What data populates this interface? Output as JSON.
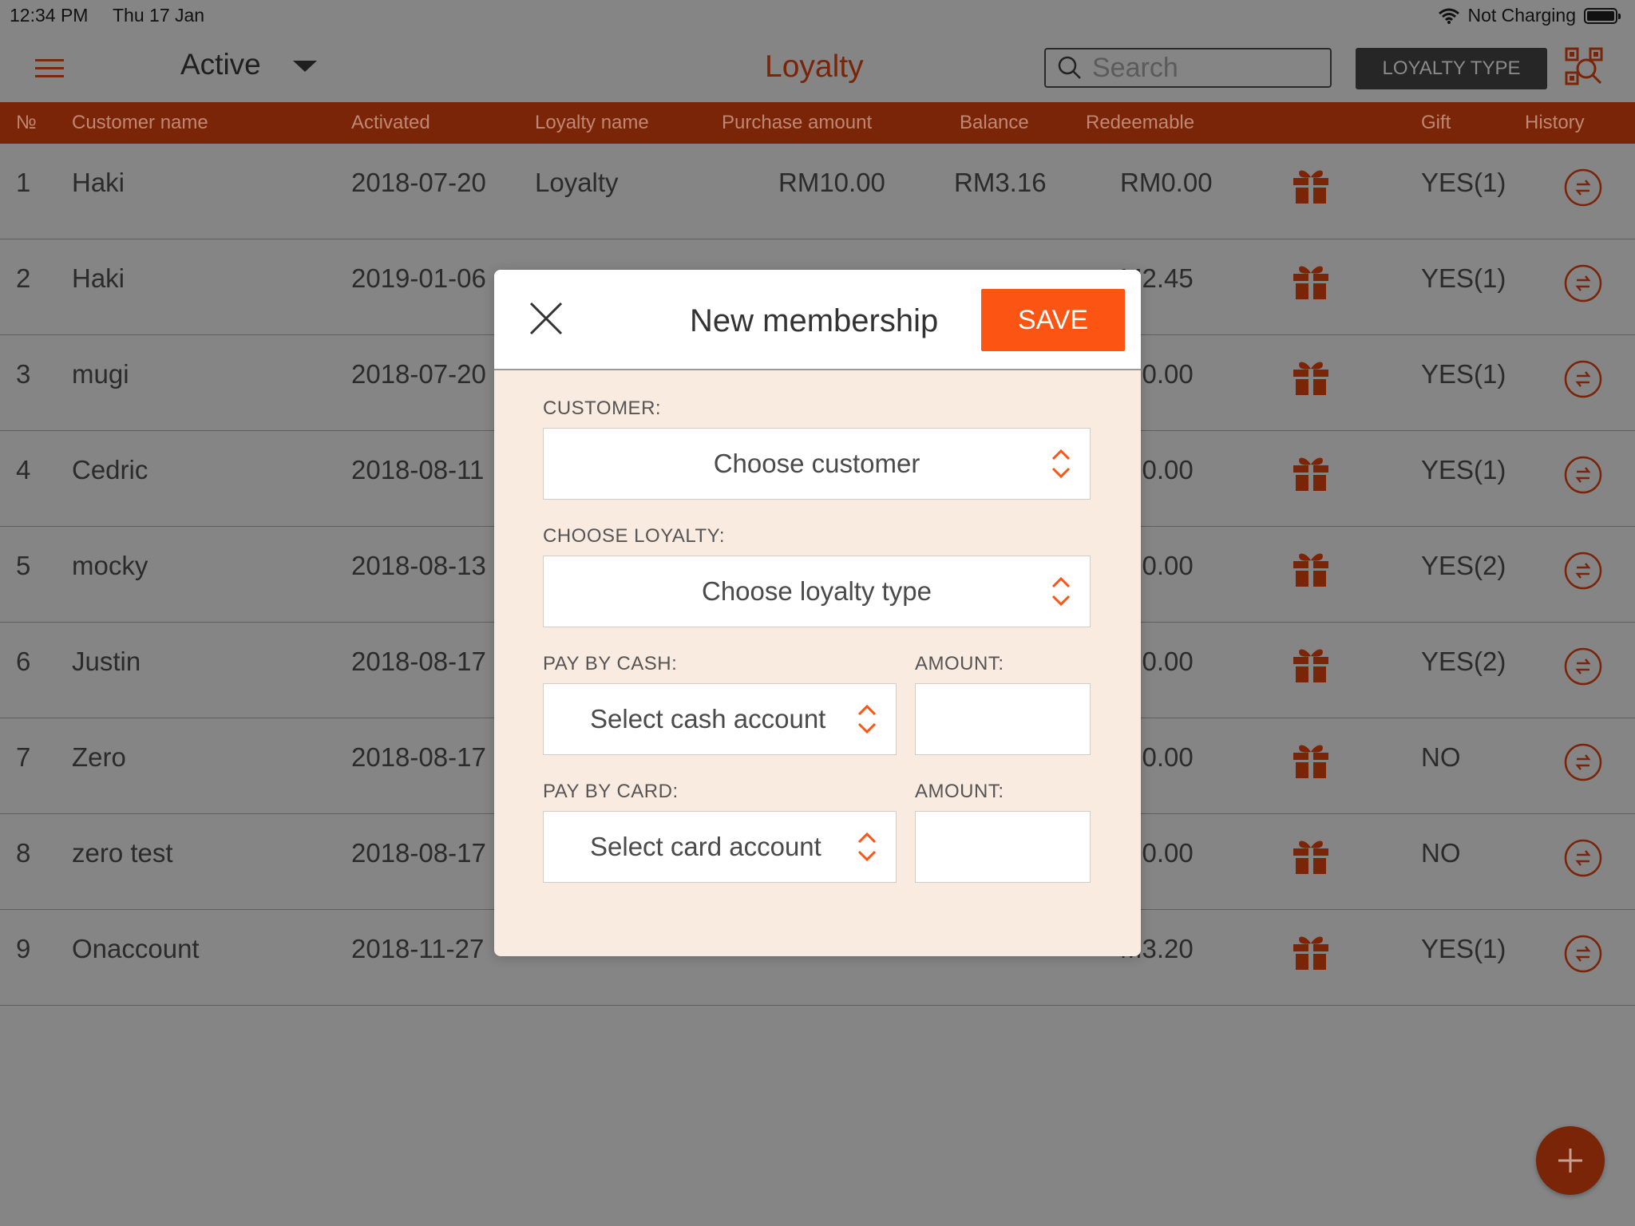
{
  "status": {
    "time": "12:34 PM",
    "date": "Thu 17 Jan",
    "charging": "Not Charging"
  },
  "header": {
    "filter": "Active",
    "title": "Loyalty",
    "search_placeholder": "Search",
    "loyalty_type_label": "LOYALTY TYPE"
  },
  "columns": {
    "no": "№",
    "customer": "Customer name",
    "activated": "Activated",
    "loyalty": "Loyalty name",
    "purchase": "Purchase amount",
    "balance": "Balance",
    "redeemable": "Redeemable",
    "gift": "Gift",
    "history": "History"
  },
  "rows": [
    {
      "no": "1",
      "customer": "Haki",
      "activated": "2018-07-20",
      "loyalty": "Loyalty",
      "purchase": "RM10.00",
      "balance": "RM3.16",
      "redeemable": "RM0.00",
      "gift": "YES(1)"
    },
    {
      "no": "2",
      "customer": "Haki",
      "activated": "2019-01-06",
      "loyalty": "",
      "purchase": "",
      "balance": "",
      "redeemable": "M2.45",
      "gift": "YES(1)"
    },
    {
      "no": "3",
      "customer": "mugi",
      "activated": "2018-07-20",
      "loyalty": "",
      "purchase": "",
      "balance": "",
      "redeemable": "M0.00",
      "gift": "YES(1)"
    },
    {
      "no": "4",
      "customer": "Cedric",
      "activated": "2018-08-11",
      "loyalty": "",
      "purchase": "",
      "balance": "",
      "redeemable": "M0.00",
      "gift": "YES(1)"
    },
    {
      "no": "5",
      "customer": "mocky",
      "activated": "2018-08-13",
      "loyalty": "",
      "purchase": "",
      "balance": "",
      "redeemable": "M0.00",
      "gift": "YES(2)"
    },
    {
      "no": "6",
      "customer": "Justin",
      "activated": "2018-08-17",
      "loyalty": "",
      "purchase": "",
      "balance": "",
      "redeemable": "M0.00",
      "gift": "YES(2)"
    },
    {
      "no": "7",
      "customer": "Zero",
      "activated": "2018-08-17",
      "loyalty": "",
      "purchase": "",
      "balance": "",
      "redeemable": "M0.00",
      "gift": "NO"
    },
    {
      "no": "8",
      "customer": "zero test",
      "activated": "2018-08-17",
      "loyalty": "",
      "purchase": "",
      "balance": "",
      "redeemable": "M0.00",
      "gift": "NO"
    },
    {
      "no": "9",
      "customer": "Onaccount",
      "activated": "2018-11-27",
      "loyalty": "",
      "purchase": "",
      "balance": "",
      "redeemable": "M3.20",
      "gift": "YES(1)"
    }
  ],
  "modal": {
    "title": "New membership",
    "save": "SAVE",
    "customer_label": "CUSTOMER:",
    "customer_value": "Choose customer",
    "loyalty_label": "CHOOSE LOYALTY:",
    "loyalty_value": "Choose loyalty type",
    "cash_label": "PAY BY CASH:",
    "cash_value": "Select cash account",
    "cash_amount_label": "AMOUNT:",
    "card_label": "PAY BY CARD:",
    "card_value": "Select card account",
    "card_amount_label": "AMOUNT:"
  },
  "colors": {
    "accent": "#fb5413",
    "header_bar": "#7a2408",
    "overlay": "#858585",
    "modal_bg": "#faebe0"
  }
}
